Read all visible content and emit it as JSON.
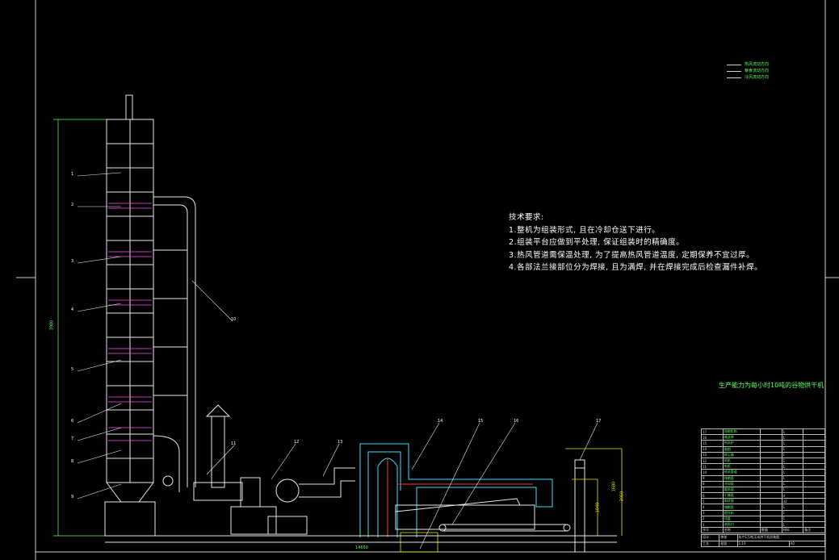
{
  "drawing": {
    "tech_requirements": {
      "heading": "技术要求:",
      "items": [
        "1.整机为组装形式, 且在冷却仓送下进行。",
        "2.组装平台应做到平处理, 保证组装时的精确度。",
        "3.热风管道需保温处理, 为了提高热风管道温度, 定期保养不宜过厚。",
        "4.各部法兰接部位分为焊接, 且为满焊, 并在焊接完成后检查漏件补焊。"
      ]
    },
    "green_title": "生产能力为每小时10吨的谷物烘干机",
    "legend": [
      {
        "label": "热风流动方向"
      },
      {
        "label": "粮食流动方向"
      },
      {
        "label": "冷风流动方向"
      }
    ],
    "part_labels": [
      "1",
      "2",
      "3",
      "4",
      "5",
      "6",
      "7",
      "8",
      "9",
      "10",
      "11",
      "12",
      "13",
      "14",
      "15",
      "16",
      "17"
    ],
    "dims": {
      "tower_height": "3900",
      "base_length": "14650",
      "r1": "3050",
      "r2": "1680",
      "r3": "1040"
    },
    "title_block": {
      "rows": [
        [
          "17",
          "排粮机构",
          "",
          "1",
          ""
        ],
        [
          "16",
          "输送带",
          "",
          "1",
          ""
        ],
        [
          "15",
          "热风炉",
          "",
          "1",
          ""
        ],
        [
          "14",
          "烟囱",
          "",
          "1",
          ""
        ],
        [
          "13",
          "除尘器",
          "",
          "1",
          ""
        ],
        [
          "12",
          "风机",
          "",
          "1",
          ""
        ],
        [
          "11",
          "电机",
          "",
          "1",
          ""
        ],
        [
          "10",
          "热风管道",
          "",
          "1",
          ""
        ],
        [
          "9",
          "排粮段",
          "",
          "1",
          ""
        ],
        [
          "8",
          "冷却段",
          "",
          "1",
          ""
        ],
        [
          "7",
          "缓苏段",
          "",
          "1",
          ""
        ],
        [
          "6",
          "干燥段",
          "",
          "4",
          ""
        ],
        [
          "5",
          "角状管",
          "",
          "32",
          ""
        ],
        [
          "4",
          "储粮段",
          "",
          "1",
          ""
        ],
        [
          "3",
          "提升机",
          "",
          "1",
          ""
        ],
        [
          "2",
          "顶盖",
          "",
          "1",
          ""
        ],
        [
          "1",
          "进料口",
          "",
          "1",
          ""
        ]
      ],
      "header": [
        "序号",
        "名称",
        "数量",
        "材料",
        "备注"
      ],
      "drawing_name": "年产1万吨玉米烘干机总装图",
      "scale": "1:10",
      "sheet": "A0",
      "footer_labels": [
        "设计",
        "审核",
        "工艺",
        "批准"
      ]
    }
  }
}
